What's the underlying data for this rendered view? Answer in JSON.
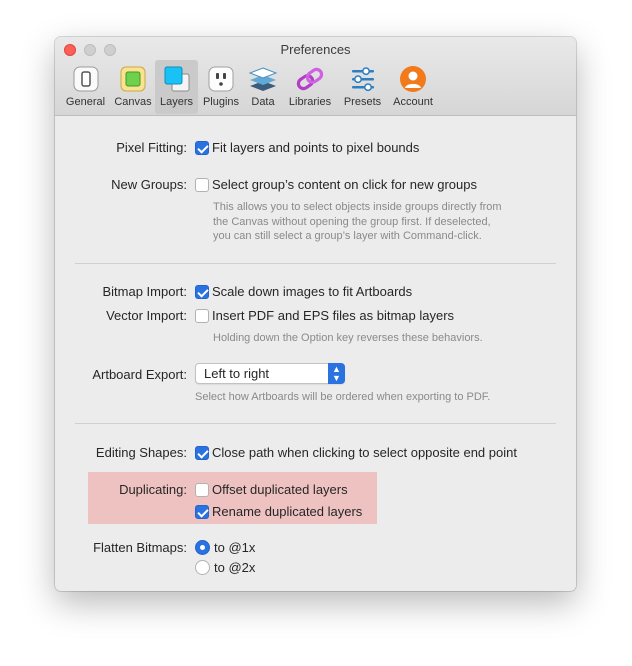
{
  "window": {
    "title": "Preferences"
  },
  "toolbar": {
    "items": [
      {
        "label": "General",
        "icon": "phone-icon"
      },
      {
        "label": "Canvas",
        "icon": "canvas-icon"
      },
      {
        "label": "Layers",
        "icon": "layers-icon",
        "selected": true
      },
      {
        "label": "Plugins",
        "icon": "plug-icon"
      },
      {
        "label": "Data",
        "icon": "data-stack-icon"
      },
      {
        "label": "Libraries",
        "icon": "libraries-icon"
      },
      {
        "label": "Presets",
        "icon": "sliders-icon"
      },
      {
        "label": "Account",
        "icon": "account-icon"
      }
    ]
  },
  "pixel_fitting": {
    "label": "Pixel Fitting:",
    "option": "Fit layers and points to pixel bounds",
    "checked": true
  },
  "new_groups": {
    "label": "New Groups:",
    "option": "Select group’s content on click for new groups",
    "checked": false,
    "help_lines": [
      "This allows you to select objects inside groups directly from",
      "the Canvas without opening the group first. If deselected,",
      "you can still select a group’s layer with Command-click."
    ]
  },
  "bitmap_import": {
    "label": "Bitmap Import:",
    "option": "Scale down images to fit Artboards",
    "checked": true
  },
  "vector_import": {
    "label": "Vector Import:",
    "option": "Insert PDF and EPS files as bitmap layers",
    "checked": false,
    "help": "Holding down the Option key reverses these behaviors."
  },
  "artboard_export": {
    "label": "Artboard Export:",
    "value": "Left to right",
    "help": "Select how Artboards will be ordered when exporting to PDF."
  },
  "editing_shapes": {
    "label": "Editing Shapes:",
    "option": "Close path when clicking to select opposite end point",
    "checked": true
  },
  "duplicating": {
    "label": "Duplicating:",
    "options": [
      {
        "label": "Offset duplicated layers",
        "checked": false
      },
      {
        "label": "Rename duplicated layers",
        "checked": true
      }
    ]
  },
  "flatten_bitmaps": {
    "label": "Flatten Bitmaps:",
    "options": [
      {
        "label": "to @1x",
        "selected": true
      },
      {
        "label": "to @2x",
        "selected": false
      }
    ]
  },
  "colors": {
    "accent": "#2a72e0",
    "highlight": "#efc2c2",
    "close_button": "#fe5f57"
  }
}
